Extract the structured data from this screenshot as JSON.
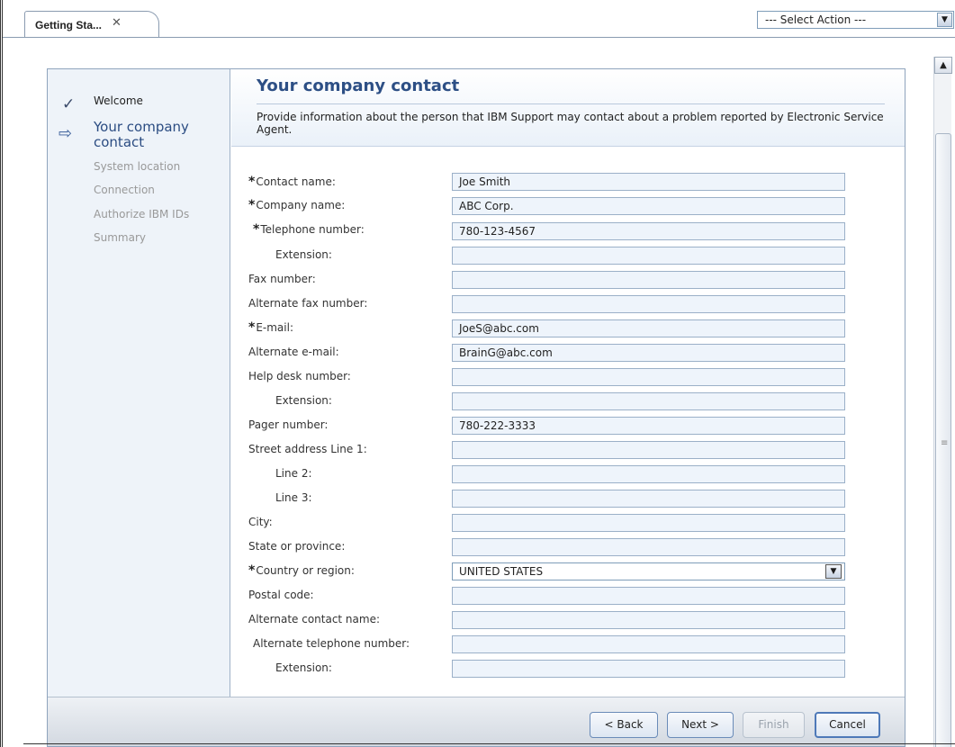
{
  "tab": {
    "label": "Getting Sta...",
    "close": "✕"
  },
  "action_select": {
    "value": "--- Select Action ---",
    "arrow": "▼"
  },
  "nav": {
    "items": [
      {
        "label": "Welcome",
        "state": "done"
      },
      {
        "label": "Your company contact",
        "state": "current"
      },
      {
        "label": "System location",
        "state": "pending"
      },
      {
        "label": "Connection",
        "state": "pending"
      },
      {
        "label": "Authorize IBM IDs",
        "state": "pending"
      },
      {
        "label": "Summary",
        "state": "pending"
      }
    ]
  },
  "header": {
    "title": "Your company contact",
    "description": "Provide information about the person that IBM Support may contact about a problem reported by Electronic Service Agent."
  },
  "form": {
    "required_marker": "*",
    "fields": [
      {
        "label": "Contact name:",
        "value": "Joe Smith",
        "required": true
      },
      {
        "label": "Company name:",
        "value": "ABC Corp.",
        "required": true
      },
      {
        "label": "Telephone number:",
        "value": "780-123-4567",
        "required": true
      },
      {
        "label": "Extension:",
        "value": "",
        "required": false
      },
      {
        "label": "Fax number:",
        "value": "",
        "required": false
      },
      {
        "label": "Alternate fax number:",
        "value": "",
        "required": false
      },
      {
        "label": "E-mail:",
        "value": "JoeS@abc.com",
        "required": true
      },
      {
        "label": "Alternate e-mail:",
        "value": "BrainG@abc.com",
        "required": false
      },
      {
        "label": "Help desk number:",
        "value": "",
        "required": false
      },
      {
        "label": "Extension:",
        "value": "",
        "required": false
      },
      {
        "label": "Pager number:",
        "value": "780-222-3333",
        "required": false
      },
      {
        "label": "Street address Line 1:",
        "value": "",
        "required": false
      },
      {
        "label": "Line 2:",
        "value": "",
        "required": false
      },
      {
        "label": "Line 3:",
        "value": "",
        "required": false
      },
      {
        "label": "City:",
        "value": "",
        "required": false
      },
      {
        "label": "State or province:",
        "value": "",
        "required": false
      },
      {
        "label": "Country or region:",
        "value": "UNITED STATES",
        "required": true,
        "type": "select"
      },
      {
        "label": "Postal code:",
        "value": "",
        "required": false
      },
      {
        "label": "Alternate contact name:",
        "value": "",
        "required": false
      },
      {
        "label": "Alternate telephone number:",
        "value": "",
        "required": false
      },
      {
        "label": "Extension:",
        "value": "",
        "required": false
      }
    ],
    "select_arrow": "▼"
  },
  "footer": {
    "back_label": "< Back",
    "next_label": "Next >",
    "finish_label": "Finish",
    "cancel_label": "Cancel"
  },
  "scrollbar": {
    "up_arrow": "▲",
    "grip": "≡"
  },
  "colors": {
    "title": "#2d4f85",
    "nav_background": "#eef3f9",
    "field_background": "#eef4fb",
    "field_border": "#9bb0c8"
  }
}
